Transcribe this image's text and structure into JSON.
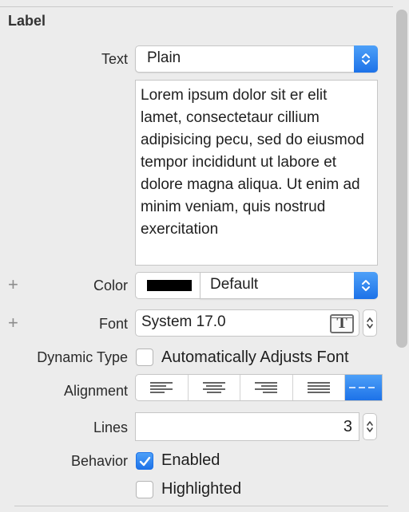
{
  "section": {
    "title": "Label"
  },
  "text": {
    "label": "Text",
    "type_value": "Plain",
    "content": "Lorem ipsum dolor sit er elit lamet, consectetaur cillium adipisicing pecu, sed do eiusmod tempor incididunt ut labore et dolore magna aliqua. Ut enim ad minim veniam, quis nostrud exercitation"
  },
  "color": {
    "label": "Color",
    "value": "Default",
    "swatch": "#000000"
  },
  "font": {
    "label": "Font",
    "value": "System 17.0",
    "icon": "font-picker-icon"
  },
  "dynamic_type": {
    "label": "Dynamic Type",
    "checkbox_label": "Automatically Adjusts Font",
    "checked": false
  },
  "alignment": {
    "label": "Alignment",
    "options": [
      "left",
      "center",
      "right",
      "justified",
      "natural"
    ],
    "selected": "natural"
  },
  "lines": {
    "label": "Lines",
    "value": "3"
  },
  "behavior": {
    "label": "Behavior",
    "enabled_label": "Enabled",
    "enabled_checked": true,
    "highlighted_label": "Highlighted",
    "highlighted_checked": false
  },
  "colors": {
    "accent": "#1d72e8",
    "background": "#ececec"
  }
}
